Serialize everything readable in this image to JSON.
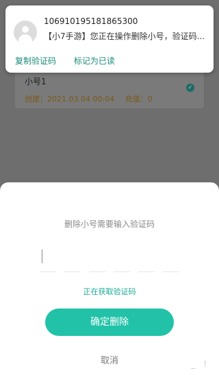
{
  "notification": {
    "sender": "106910195181865300",
    "message": "【小7手游】您正在操作删除小号，验证码...",
    "actions": [
      "复制验证码",
      "标记为已读"
    ]
  },
  "background_list": {
    "item": {
      "name": "小号1",
      "created": "创建：2021.03.04 00:04",
      "recharge": "充值：0"
    }
  },
  "sheet": {
    "title": "删除小号需要输入验证码",
    "status": "正在获取验证码",
    "confirm_label": "确定删除",
    "cancel_label": "取消"
  },
  "colors": {
    "accent": "#22c2a8",
    "accent_text": "#1aa995",
    "notif_action": "#1b8a7a"
  }
}
